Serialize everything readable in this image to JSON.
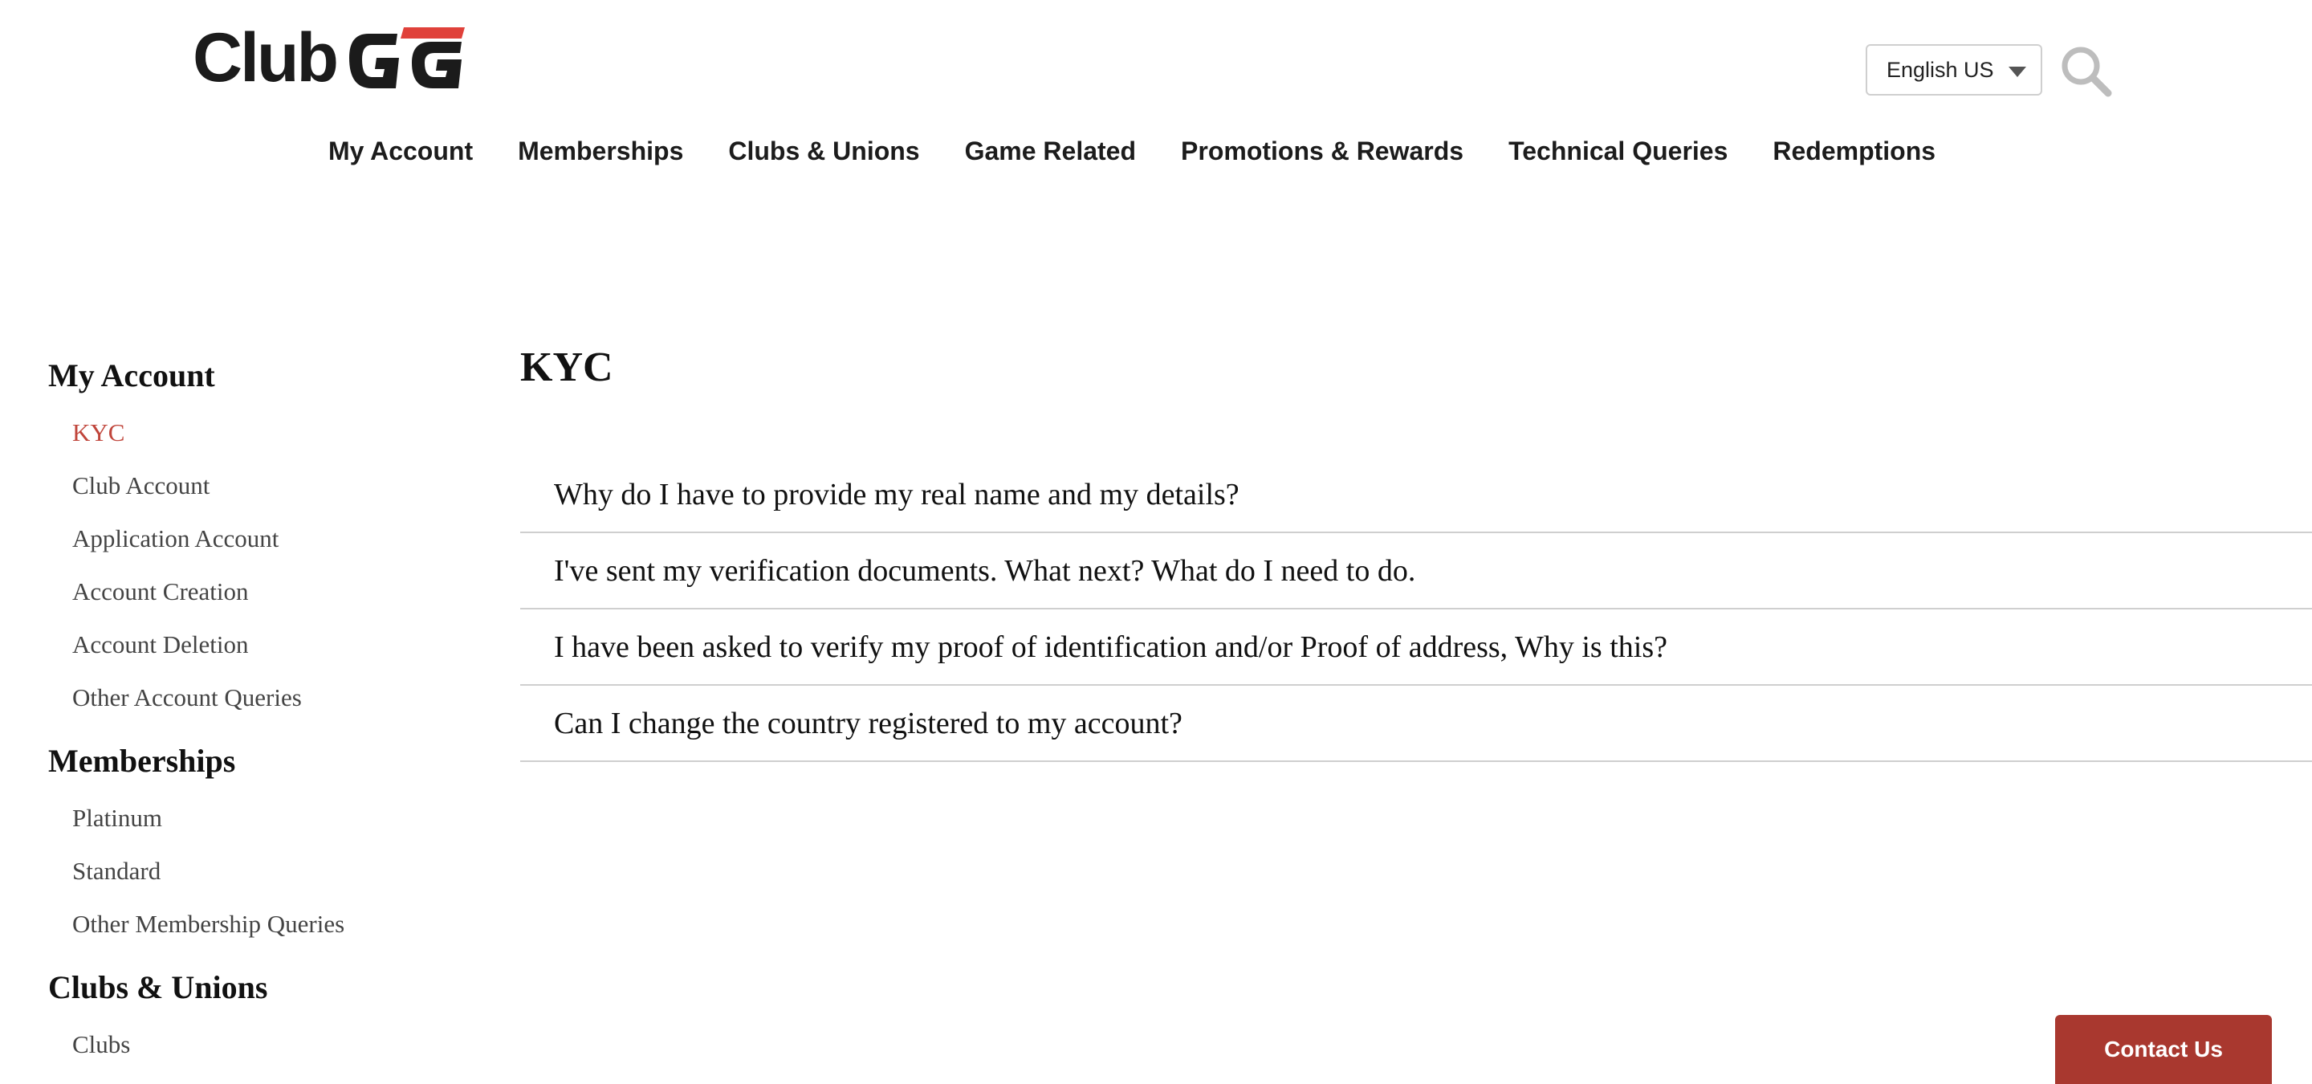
{
  "header": {
    "logo_text": "Club",
    "logo_mark": "GG",
    "language": "English US",
    "icons": {
      "search": "search-icon",
      "caret": "chevron-down-icon"
    }
  },
  "nav": [
    "My Account",
    "Memberships",
    "Clubs & Unions",
    "Game Related",
    "Promotions & Rewards",
    "Technical Queries",
    "Redemptions"
  ],
  "sidebar": {
    "sections": [
      {
        "title": "My Account",
        "items": [
          "KYC",
          "Club Account",
          "Application Account",
          "Account Creation",
          "Account Deletion",
          "Other Account Queries"
        ]
      },
      {
        "title": "Memberships",
        "items": [
          "Platinum",
          "Standard",
          "Other Membership Queries"
        ]
      },
      {
        "title": "Clubs & Unions",
        "items": [
          "Clubs"
        ]
      }
    ],
    "active_item": "KYC"
  },
  "main": {
    "title": "KYC",
    "questions": [
      "Why do I have to provide my real name and my details?",
      "I've sent my verification documents. What next? What do I need to do.",
      "I have been asked to verify my proof of identification and/or Proof of address, Why is this?",
      "Can I change the country registered to my account?"
    ]
  },
  "contact": {
    "label": "Contact Us"
  },
  "colors": {
    "accent": "#c0453b",
    "button": "#a9382f",
    "logo_red": "#e0413a",
    "divider": "#cfcfcf"
  }
}
